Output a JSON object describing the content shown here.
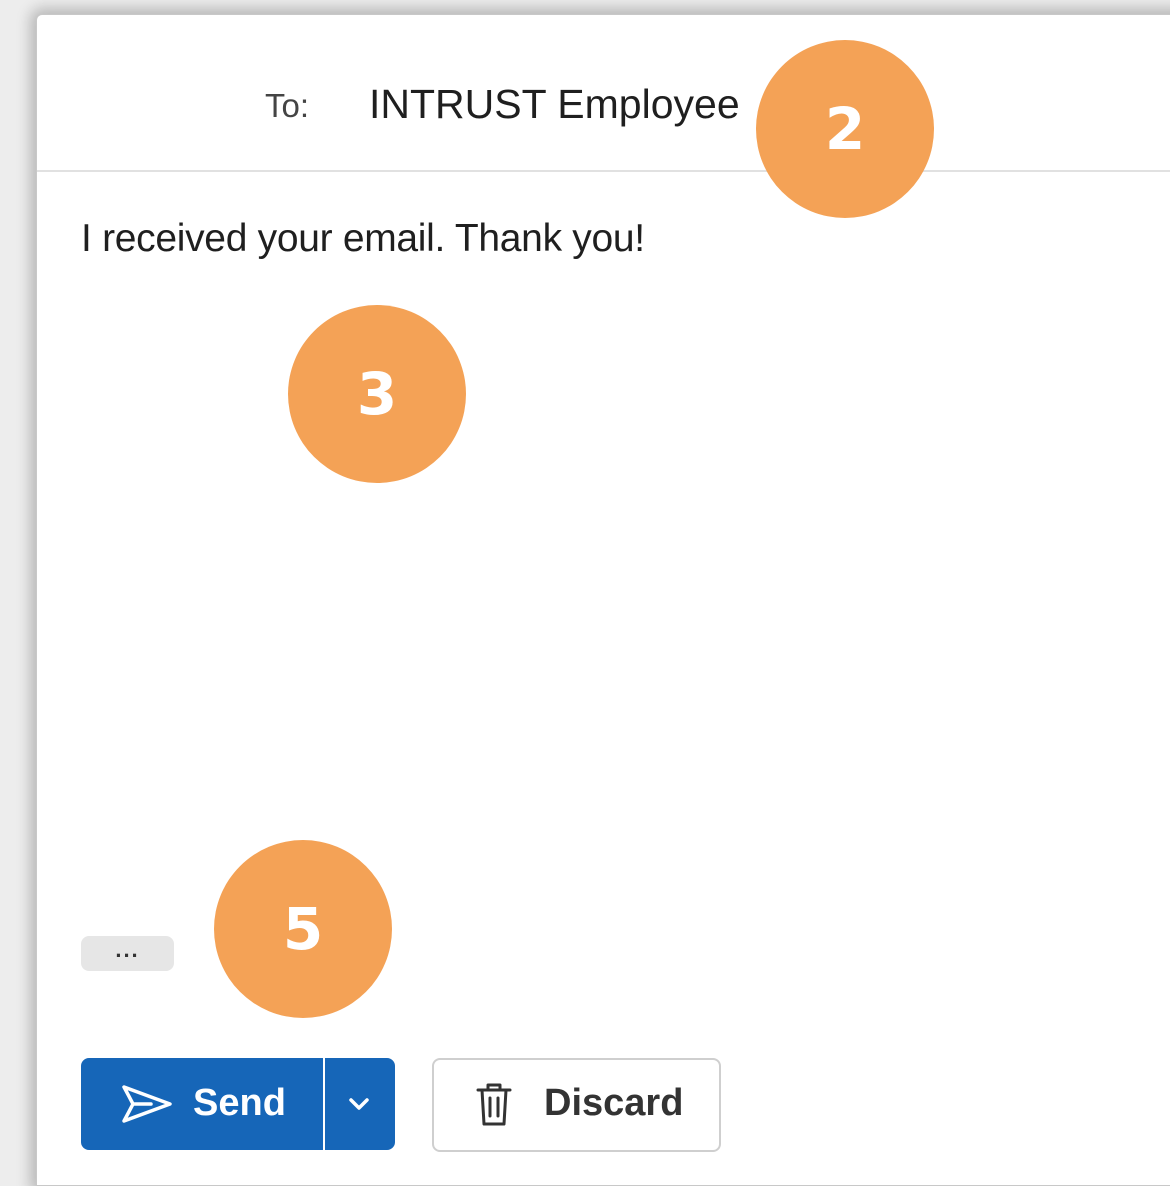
{
  "compose": {
    "to_label": "To:",
    "recipient": "INTRUST Employee",
    "body": "I received your email. Thank you!"
  },
  "toolbar": {
    "more_label": "...",
    "send_label": "Send",
    "discard_label": "Discard"
  },
  "annotations": {
    "step_recipient": "2",
    "step_body": "3",
    "step_send": "5"
  },
  "colors": {
    "send_button": "#1666b8",
    "badge": "#f4a256"
  },
  "icons": {
    "send": "send-icon",
    "chevron": "chevron-down-icon",
    "trash": "trash-icon"
  }
}
